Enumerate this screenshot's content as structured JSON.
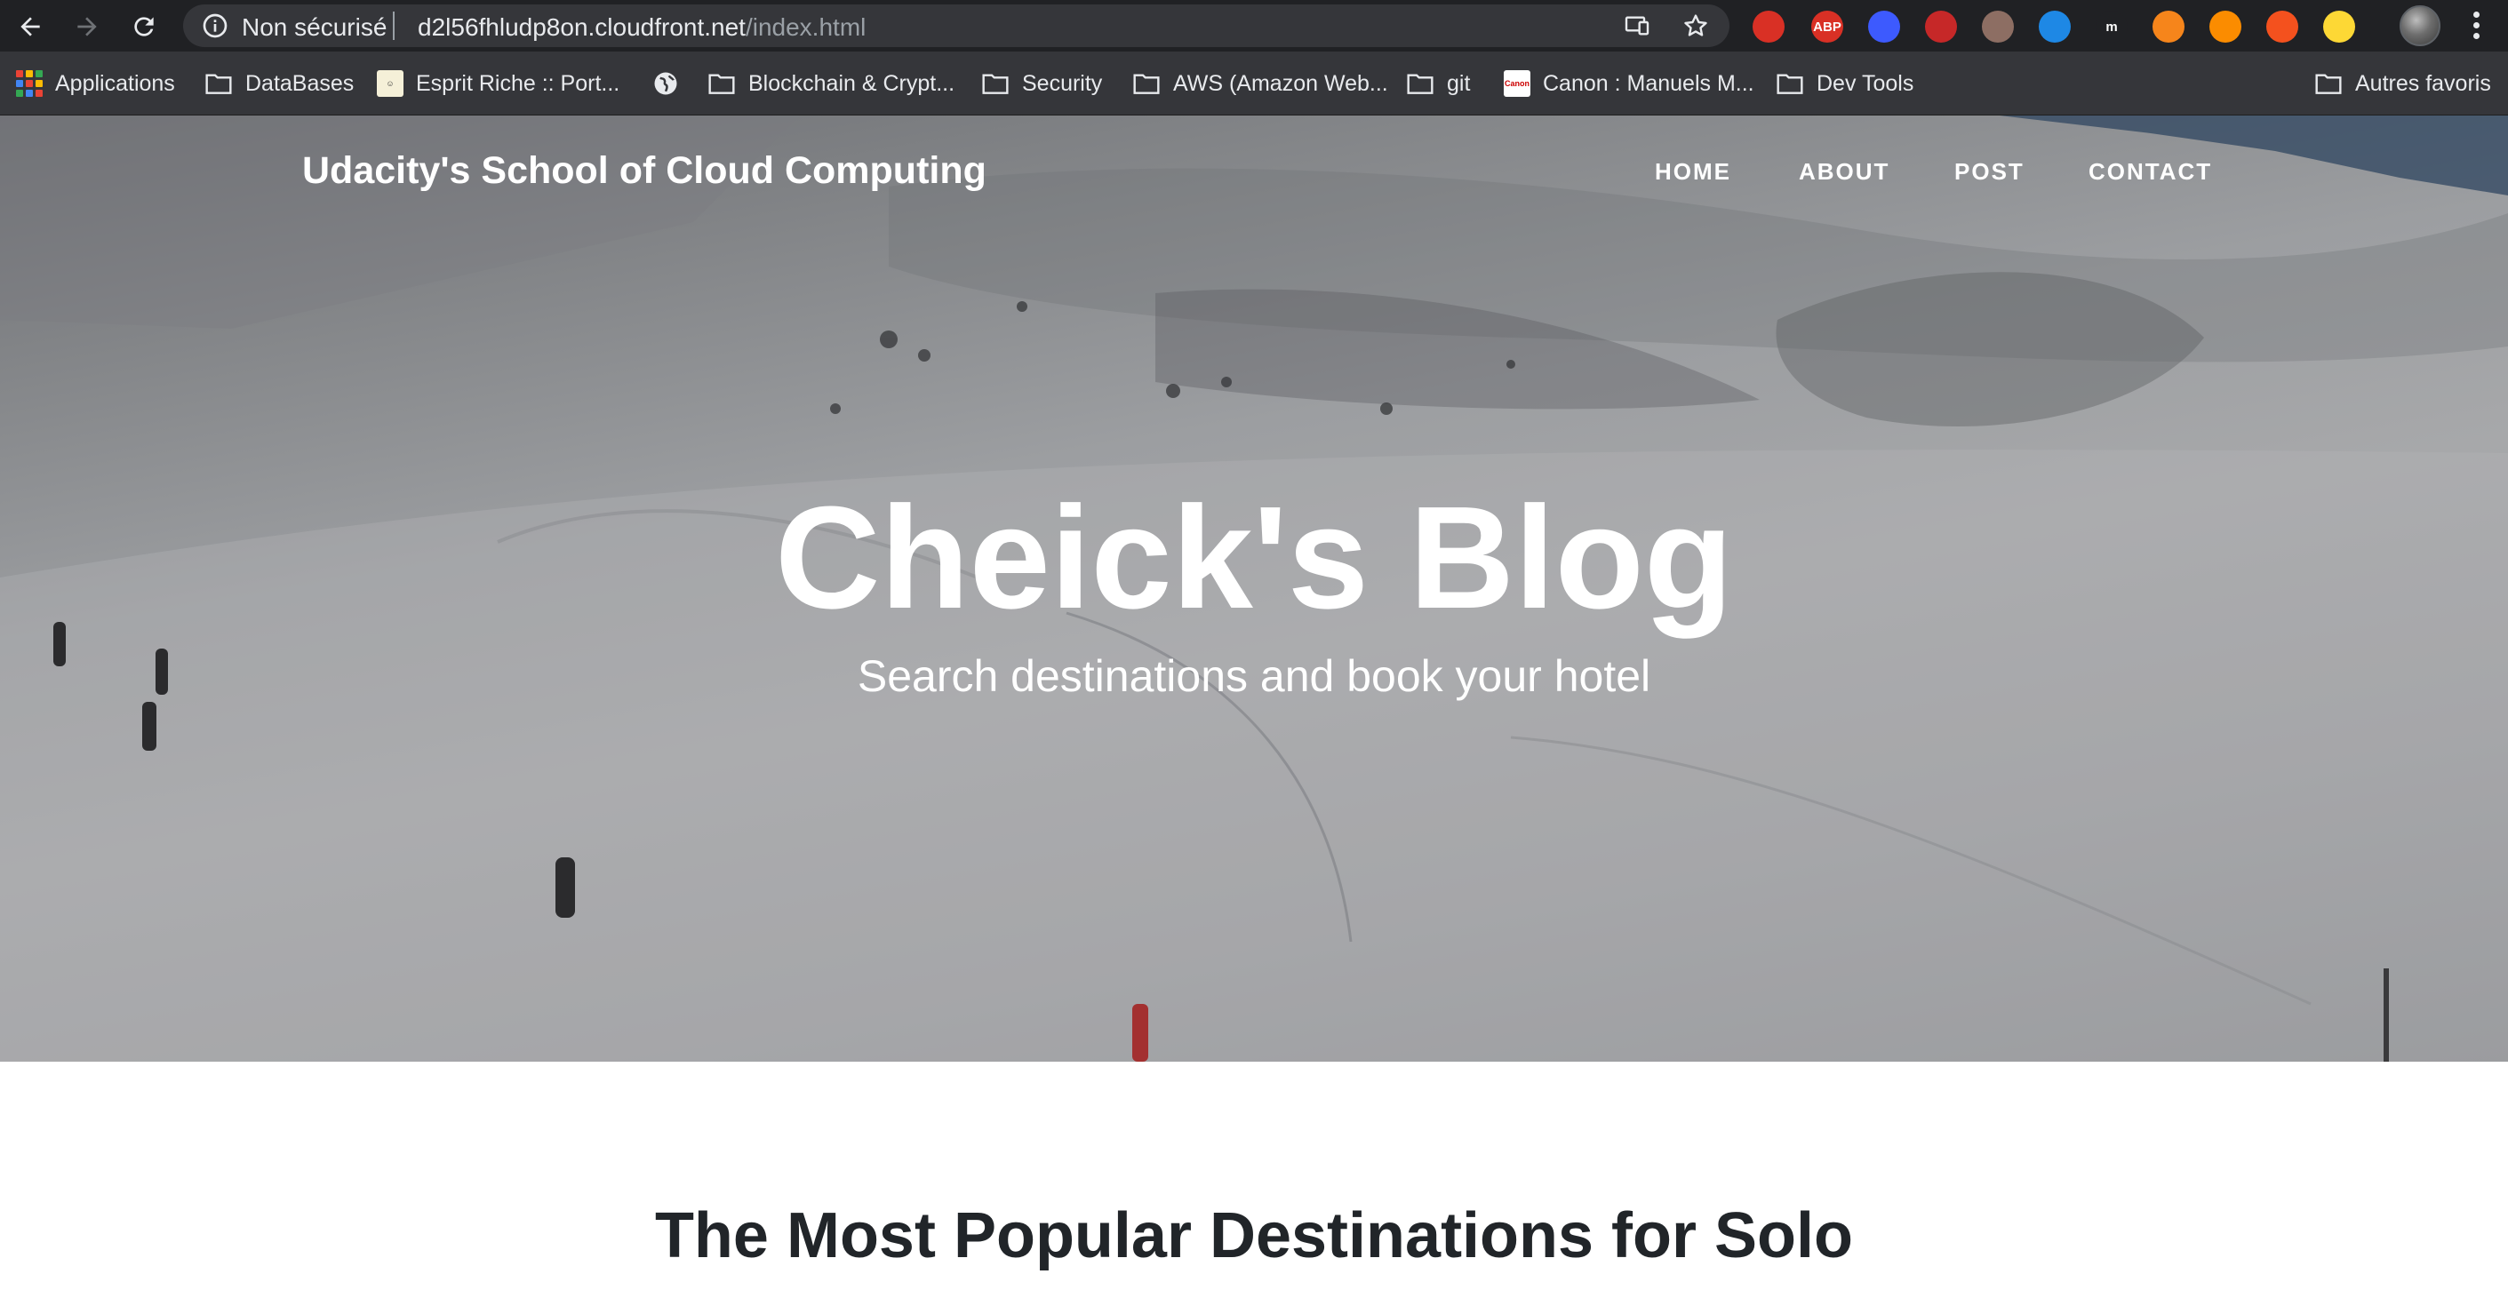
{
  "browser": {
    "security_status": "Non sécurisé",
    "url_host": "d2l56fhludp8on.cloudfront.net",
    "url_path": "/index.html",
    "extensions": [
      {
        "icon": "stop-hand-icon",
        "label": "",
        "color": "#d93025"
      },
      {
        "icon": "adblock-plus-icon",
        "label": "ABP",
        "color": "#d93025"
      },
      {
        "icon": "privacy-badger-icon",
        "label": "",
        "color": "#3d5afe"
      },
      {
        "icon": "santa-extension-icon",
        "label": "",
        "color": "#c62828"
      },
      {
        "icon": "monkey-extension-icon",
        "label": "",
        "color": "#8d6e63"
      },
      {
        "icon": "chart-extension-icon",
        "label": "",
        "color": "#1e88e5"
      },
      {
        "icon": "m-extension-icon",
        "label": "m",
        "color": "#202124"
      },
      {
        "icon": "metamask-fox-icon",
        "label": "",
        "color": "#f6851b"
      },
      {
        "icon": "play-extension-icon",
        "label": "",
        "color": "#fb8c00"
      },
      {
        "icon": "diamond-extension-icon",
        "label": "",
        "color": "#f4511e"
      },
      {
        "icon": "ghost-extension-icon",
        "label": "",
        "color": "#fdd835"
      }
    ]
  },
  "bookmarks": {
    "apps": "Applications",
    "items": [
      "DataBases",
      "Esprit Riche :: Port...",
      "Blockchain & Crypt...",
      "Security",
      "AWS (Amazon Web...",
      "git",
      "Canon : Manuels M...",
      "Dev Tools"
    ],
    "other": "Autres favoris"
  },
  "site": {
    "brand": "Udacity's School of Cloud Computing",
    "nav": [
      "HOME",
      "ABOUT",
      "POST",
      "CONTACT"
    ],
    "hero_title": "Cheick's Blog",
    "hero_subtitle": "Search destinations and book your hotel",
    "section_heading": "The Most Popular Destinations for Solo"
  },
  "colors": {
    "chrome_toolbar": "#202124",
    "bookmarks_bar": "#35363a",
    "heading_text": "#212529"
  }
}
